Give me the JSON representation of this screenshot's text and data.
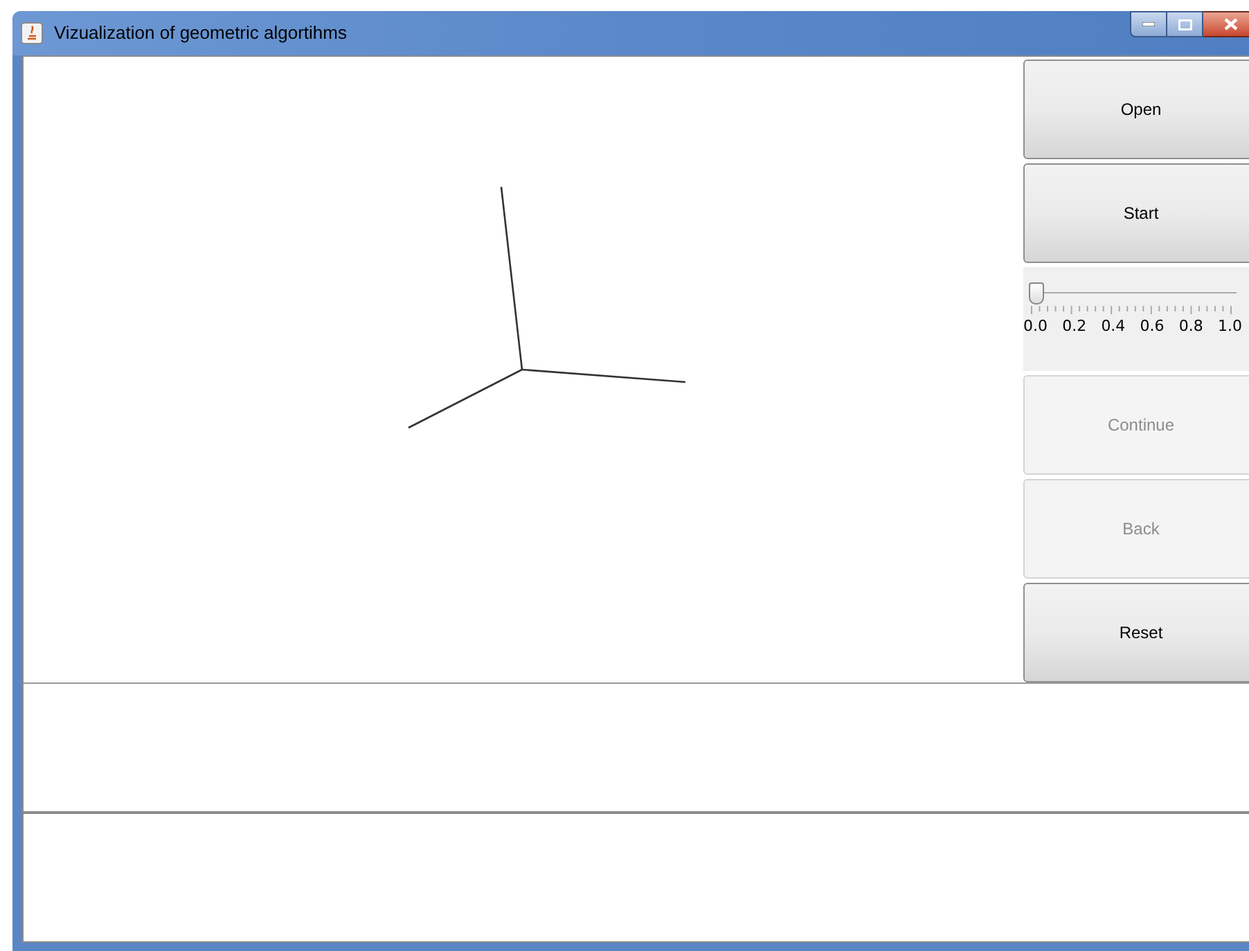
{
  "window": {
    "title": "Vizualization of geometric algortihms"
  },
  "controls": [
    {
      "kind": "button",
      "label": "Open",
      "disabled": false
    },
    {
      "kind": "button",
      "label": "Start",
      "disabled": false
    },
    {
      "kind": "slider",
      "level": 0,
      "tick_labels": [
        "0.0",
        "0.2",
        "0.4",
        "0.6",
        "0.8",
        "1.0"
      ]
    },
    {
      "kind": "button",
      "label": "Continue",
      "disabled": true
    },
    {
      "kind": "button",
      "label": "Back",
      "disabled": true
    },
    {
      "kind": "button",
      "label": "Reset",
      "disabled": false
    }
  ]
}
